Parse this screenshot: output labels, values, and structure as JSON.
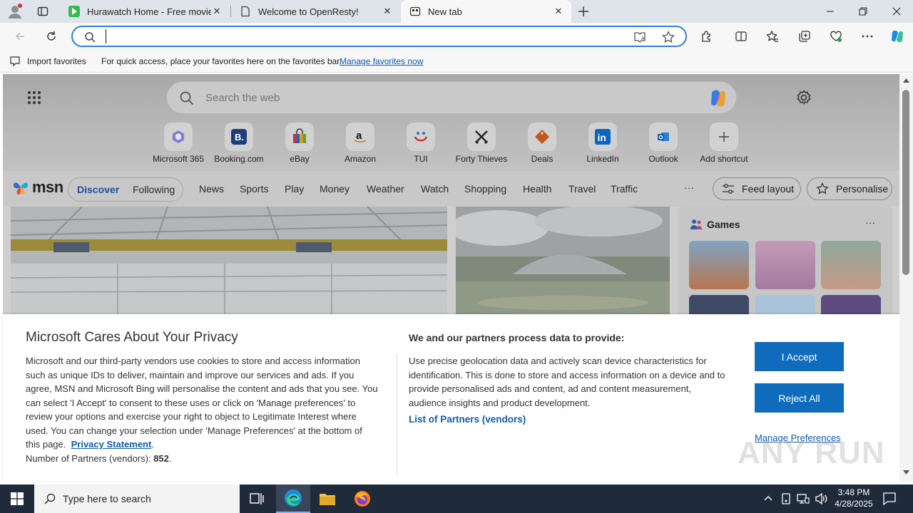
{
  "browser": {
    "tabs": [
      {
        "title": "Hurawatch Home - Free movies",
        "active": false
      },
      {
        "title": "Welcome to OpenResty!",
        "active": false
      },
      {
        "title": "New tab",
        "active": true
      }
    ],
    "address": {
      "value": "",
      "placeholder": ""
    },
    "favorites_bar": {
      "import_label": "Import favorites",
      "message": "For quick access, place your favorites here on the favorites bar.",
      "manage_link": "Manage favorites now"
    }
  },
  "newtab": {
    "search_placeholder": "Search the web",
    "shortcuts": [
      {
        "label": "Microsoft 365",
        "icon": "microsoft-365-icon"
      },
      {
        "label": "Booking.com",
        "icon": "booking-icon"
      },
      {
        "label": "eBay",
        "icon": "ebay-icon"
      },
      {
        "label": "Amazon",
        "icon": "amazon-icon"
      },
      {
        "label": "TUI",
        "icon": "tui-icon"
      },
      {
        "label": "Forty Thieves",
        "icon": "forty-thieves-icon"
      },
      {
        "label": "Deals",
        "icon": "deals-icon"
      },
      {
        "label": "LinkedIn",
        "icon": "linkedin-icon"
      },
      {
        "label": "Outlook",
        "icon": "outlook-icon"
      },
      {
        "label": "Add shortcut",
        "icon": "plus-icon"
      }
    ],
    "msn_logo": "msn",
    "nav": {
      "discover": "Discover",
      "following": "Following",
      "items": [
        "News",
        "Sports",
        "Play",
        "Money",
        "Weather",
        "Watch",
        "Shopping",
        "Health",
        "Travel",
        "Traffic"
      ],
      "more": "···",
      "feed_layout": "Feed layout",
      "personalise": "Personalise"
    },
    "games_title": "Games",
    "games_more": "···"
  },
  "privacy": {
    "title": "Microsoft Cares About Your Privacy",
    "body_lines": [
      "Microsoft and our third-party vendors use cookies to store and access information",
      "such as unique IDs to deliver, maintain and improve our services and ads. If you",
      "agree, MSN and Microsoft Bing will personalise the content and ads that you see. You",
      "can select 'I Accept' to consent to these uses or click on 'Manage preferences' to",
      "review your options and exercise your right to object to Legitimate Interest where",
      "used.  You can change your selection under 'Manage Preferences' at the bottom of"
    ],
    "body_last_prefix": "this page.",
    "privacy_link": "Privacy Statement",
    "body_last_suffix": ".",
    "partners_label": "Number of Partners (vendors):",
    "partners_count": "852",
    "partners_suffix": ".",
    "right_title": "We and our partners process data to provide:",
    "right_lines": [
      "Use precise geolocation data and actively scan device characteristics for",
      "identification. This is done to store and access information on a device and to",
      "provide personalised ads and content, ad and content measurement,",
      "audience insights and product development."
    ],
    "vendors_link": "List of Partners (vendors)",
    "accept": "I Accept",
    "reject": "Reject All",
    "manage": "Manage Preferences"
  },
  "watermark": "ANY RUN",
  "taskbar": {
    "search_placeholder": "Type here to search",
    "time": "3:48 PM",
    "date": "4/28/2025"
  },
  "colors": {
    "accent": "#0f6cbd",
    "link": "#0f6cbd",
    "taskbar": "#1f2a3a"
  }
}
